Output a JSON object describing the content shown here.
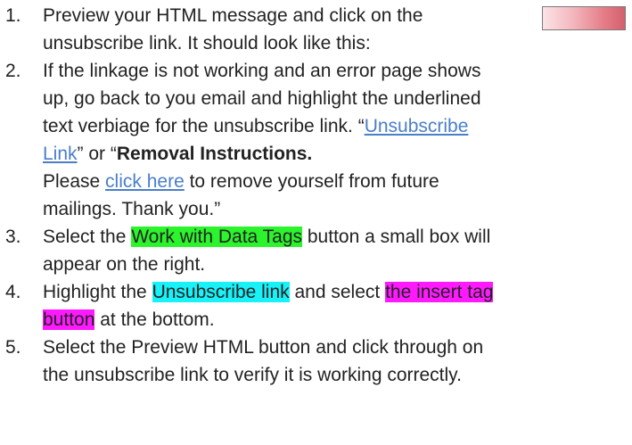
{
  "steps": [
    {
      "num": "1.",
      "lines": [
        "Preview your HTML message and click on the",
        "unsubscribe link.  It should look like this:"
      ]
    },
    {
      "num": "2.",
      "lines": [
        "If the linkage is not working and an error page shows",
        "up, go back to you email and highlight the underlined",
        "text verbiage for the unsubscribe link. “"
      ],
      "link1a": "Unsubscribe",
      "link1b": "Link",
      "mid": "” or “",
      "bold": "Removal Instructions.",
      "please": "Please ",
      "link2": "click here",
      "after": " to remove yourself from future",
      "last": "mailings. Thank you.”"
    },
    {
      "num": "3.",
      "pre": "Select the ",
      "hl": "Work with Data Tags",
      "post": " button a small box will",
      "line2": "appear on the right."
    },
    {
      "num": "4.",
      "pre": "Highlight the ",
      "hl1": "Unsubscribe link",
      "mid": " and select ",
      "hl2a": "the insert tag",
      "hl2b": "button",
      "post": " at the bottom."
    },
    {
      "num": "5.",
      "lines": [
        "Select the Preview HTML button and click through on",
        "the unsubscribe link to verify it is working correctly."
      ]
    }
  ],
  "colors": {
    "link": "#4a7ec9",
    "highlight_green": "#2cf42c",
    "highlight_cyan": "#17f1f7",
    "highlight_magenta": "#ff19ff"
  }
}
